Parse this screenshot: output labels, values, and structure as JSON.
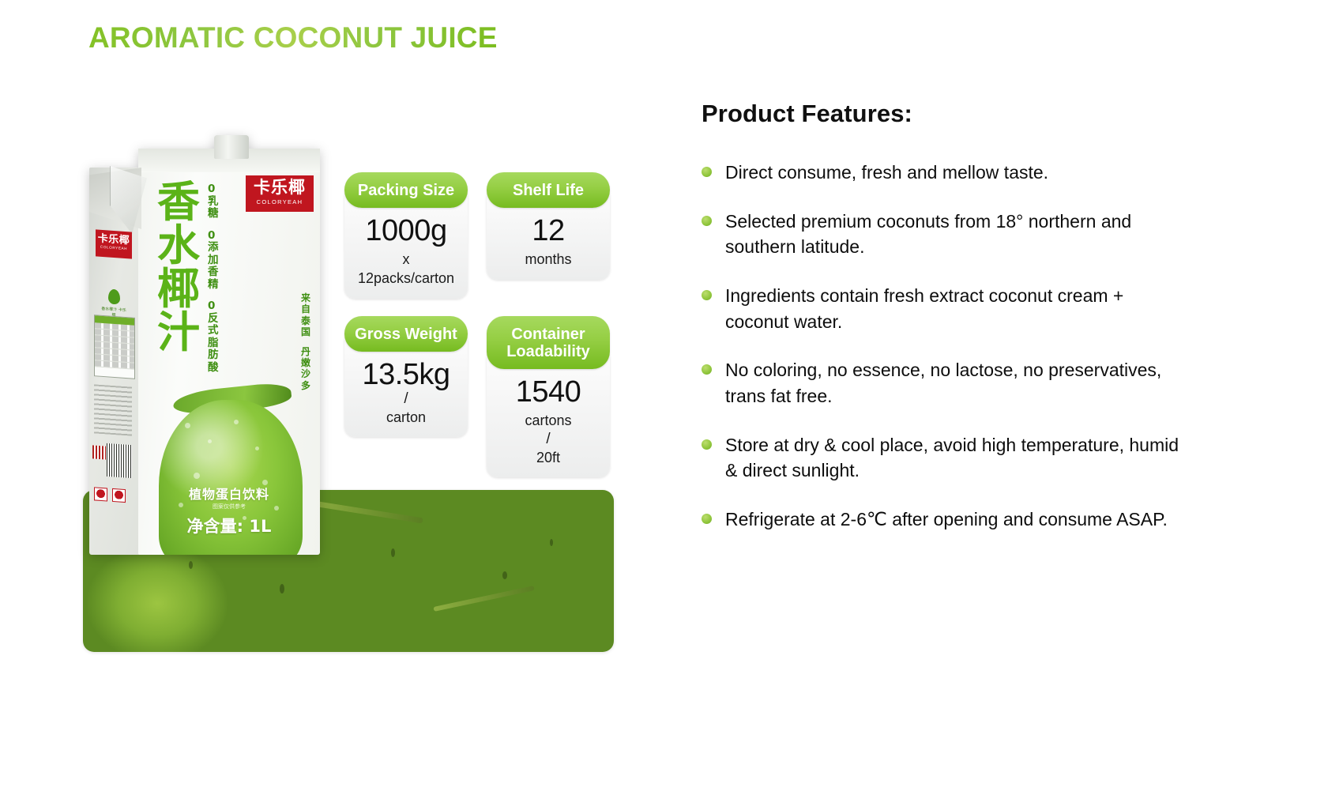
{
  "page": {
    "title": "AROMATIC COCONUT JUICE",
    "accent_green": "#8dc63f",
    "accent_green_dark": "#76bb20",
    "bullet_green": "#93c83f",
    "brand_red": "#c0161f"
  },
  "package": {
    "brand_cn": "卡乐椰",
    "brand_en": "COLORYEAH",
    "product_name_cn": "香水椰汁",
    "zero_claims": [
      "0乳糖",
      "0添加香精",
      "0反式脂肪酸"
    ],
    "origin_claims": [
      "来自泰国",
      "丹嫩沙多"
    ],
    "eco_label_cn": "香水椰汁 卡乐椰",
    "eco_label_en": "Coloryeah Coconut Water",
    "drink_type_cn": "植物蛋白饮料",
    "drink_note_cn": "图案仅供参考",
    "net_volume_cn": "净含量: 1L"
  },
  "specs": [
    {
      "label": "Packing Size",
      "value": "1000g",
      "unit": "x",
      "sep": "",
      "sub": "12packs/carton"
    },
    {
      "label": "Shelf Life",
      "value": "12",
      "unit": "months",
      "sep": "",
      "sub": ""
    },
    {
      "label": "Gross Weight",
      "value": "13.5kg",
      "unit": "",
      "sep": "/",
      "sub": "carton"
    },
    {
      "label": "Container Loadability",
      "value": "1540",
      "unit": "cartons",
      "sep": "/",
      "sub": "20ft"
    }
  ],
  "features": {
    "title": "Product Features:",
    "items": [
      "Direct consume,  fresh and mellow taste.",
      "Selected premium coconuts from 18° northern and southern latitude.",
      " Ingredients contain fresh extract coconut cream + coconut water.",
      "No coloring, no essence, no lactose, no preservatives, trans fat free.",
      "Store at dry & cool place, avoid high temperature, humid & direct sunlight.",
      "Refrigerate at 2-6℃ after opening and consume ASAP."
    ]
  },
  "icons": {
    "bullet": "bullet-dot-icon",
    "leaf": "leaf-icon",
    "barcode": "barcode-icon",
    "qrcode": "qrcode-icon",
    "recycle": "recycle-icon"
  }
}
